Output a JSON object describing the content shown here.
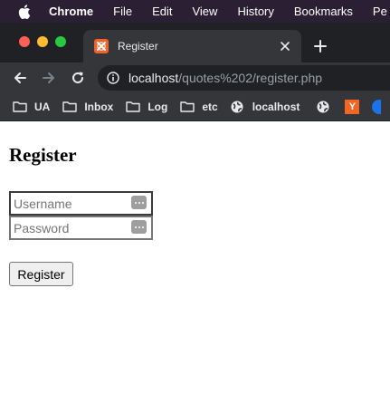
{
  "menubar": {
    "app_name": "Chrome",
    "items": [
      "File",
      "Edit",
      "View",
      "History",
      "Bookmarks",
      "Pe"
    ]
  },
  "tab": {
    "title": "Register",
    "favicon": "xampp-icon"
  },
  "toolbar": {
    "url_host": "localhost",
    "url_path": "/quotes%202/register.php"
  },
  "bookmarks": {
    "folders": [
      "UA",
      "Inbox",
      "Log",
      "etc"
    ],
    "site": "localhost",
    "extra_icon_letter": "Y"
  },
  "page": {
    "heading": "Register",
    "username_placeholder": "Username",
    "password_placeholder": "Password",
    "submit_label": "Register"
  },
  "colors": {
    "menubar_bg": "#2b1f33",
    "tabstrip_bg": "#202124",
    "toolbar_bg": "#35363a",
    "xampp_orange": "#f0622a"
  }
}
